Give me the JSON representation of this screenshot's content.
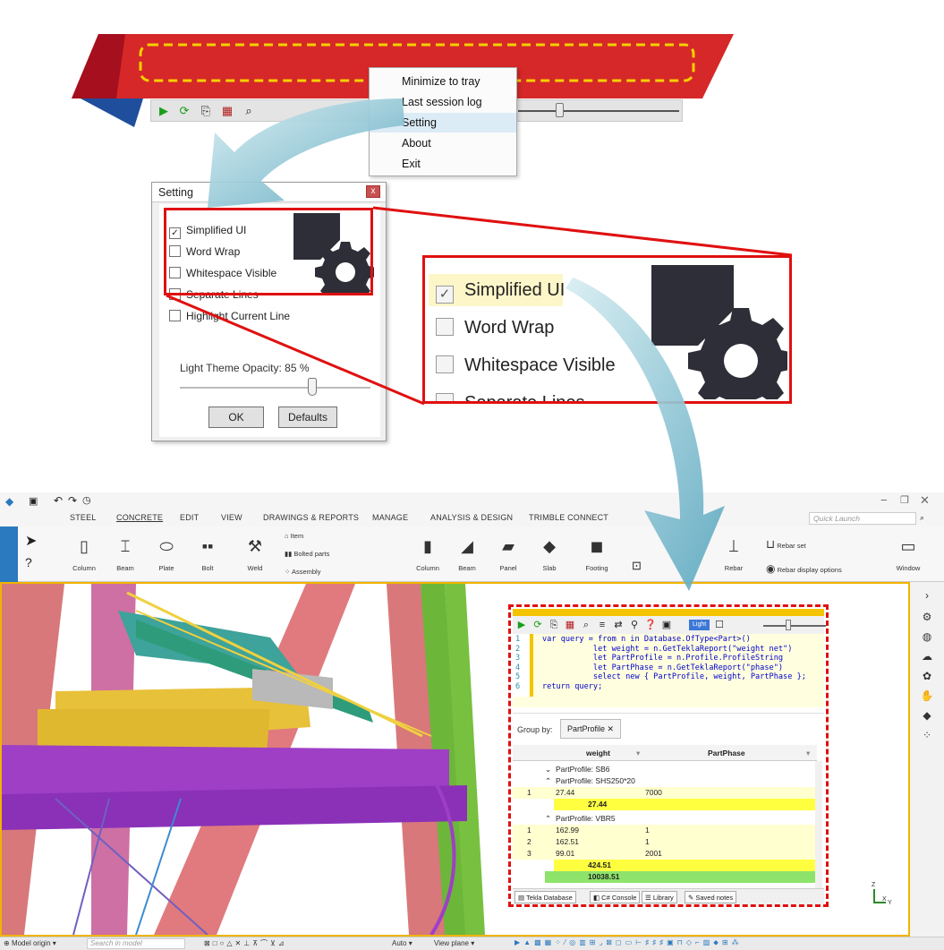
{
  "context_menu": {
    "items": [
      "Minimize to tray",
      "Last session log",
      "Setting",
      "About",
      "Exit"
    ],
    "highlighted": "Setting"
  },
  "setting_dialog": {
    "title": "Setting",
    "close_label": "x",
    "options": [
      {
        "label": "Simplified UI",
        "checked": true
      },
      {
        "label": "Word Wrap",
        "checked": false
      },
      {
        "label": "Whitespace Visible",
        "checked": false
      },
      {
        "label": "Separate Lines",
        "checked": false
      },
      {
        "label": "Highlight Current Line",
        "checked": false
      }
    ],
    "opacity_label": "Light Theme Opacity: 85 %",
    "opacity_value": 0.85,
    "ok_label": "OK",
    "defaults_label": "Defaults"
  },
  "zoom": {
    "options": [
      {
        "label": "Simplified UI",
        "checked": true
      },
      {
        "label": "Word Wrap",
        "checked": false
      },
      {
        "label": "Whitespace Visible",
        "checked": false
      },
      {
        "label": "Separate Lines",
        "checked": false
      }
    ]
  },
  "app": {
    "menu_tabs": [
      "STEEL",
      "CONCRETE",
      "EDIT",
      "VIEW",
      "DRAWINGS & REPORTS",
      "MANAGE",
      "ANALYSIS & DESIGN",
      "TRIMBLE CONNECT"
    ],
    "active_tab": "CONCRETE",
    "quick_launch_placeholder": "Quick Launch",
    "steel_tools": [
      "Column",
      "Beam",
      "Plate",
      "Bolt",
      "Weld"
    ],
    "small_tools": [
      "Item",
      "Bolted parts",
      "Assembly"
    ],
    "concrete_tools": [
      "Column",
      "Beam",
      "Panel",
      "Slab",
      "Footing"
    ],
    "rebar_tools": [
      "Rebar",
      "Rebar set",
      "Rebar display options"
    ],
    "window_label": "Window",
    "status": {
      "model_origin": "Model origin",
      "search_placeholder": "Search in model",
      "auto": "Auto",
      "view_plane": "View plane"
    },
    "axis_labels": [
      "Z",
      "X",
      "Y"
    ]
  },
  "tool": {
    "light_label": "Light",
    "code_lines": [
      "var query = from n in Database.OfType<Part>()",
      "           let weight = n.GetTeklaReport(\"weight net\")",
      "           let PartProfile = n.Profile.ProfileString",
      "           let PartPhase = n.GetTeklaReport(\"phase\")",
      "           select new { PartProfile, weight, PartPhase };",
      "return query;"
    ],
    "group_by_label": "Group by:",
    "group_by_chip": "PartProfile ✕",
    "columns": [
      "weight",
      "PartPhase"
    ],
    "groups": [
      {
        "header": "PartProfile: SB6",
        "rows": [],
        "total": ""
      },
      {
        "header": "PartProfile: SHS250*20",
        "rows": [
          {
            "n": "1",
            "weight": "27.44",
            "phase": "7000"
          }
        ],
        "total": "27.44"
      },
      {
        "header": "PartProfile: VBR5",
        "rows": [
          {
            "n": "1",
            "weight": "162.99",
            "phase": "1"
          },
          {
            "n": "2",
            "weight": "162.51",
            "phase": "1"
          },
          {
            "n": "3",
            "weight": "99.01",
            "phase": "2001"
          }
        ],
        "total": "424.51"
      }
    ],
    "grand_total": "10038.51",
    "tabs": [
      "Tekla Database",
      "C# Console",
      "Library",
      "Saved notes"
    ]
  }
}
